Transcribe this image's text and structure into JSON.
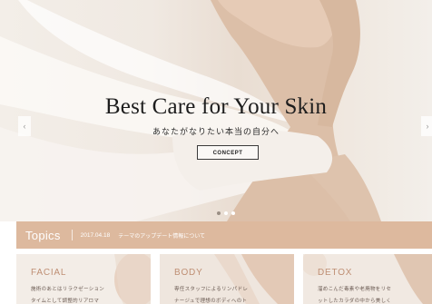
{
  "hero": {
    "title": "Best Care for Your Skin",
    "subtitle": "あなたがなりたい本当の自分へ",
    "button_label": "CONCEPT",
    "slide_count": 3,
    "active_slide": 1
  },
  "topics": {
    "label": "Topics",
    "date": "2017.04.18",
    "text": "テーマのアップデート情報について"
  },
  "cards": [
    {
      "title": "FACIAL",
      "line1": "施術のあとはリラクゼーション",
      "line2": "タイムとして調整的リアロマ"
    },
    {
      "title": "BODY",
      "line1": "専任スタッフによるリンパドレ",
      "line2": "ナージュで理想のボディへのト"
    },
    {
      "title": "DETOX",
      "line1": "溜めこんだ毒素や老廃物をリセ",
      "line2": "ットしたカラダの中から美しく"
    }
  ],
  "colors": {
    "accent": "#ddb99e",
    "card_title": "#bf8f74"
  }
}
